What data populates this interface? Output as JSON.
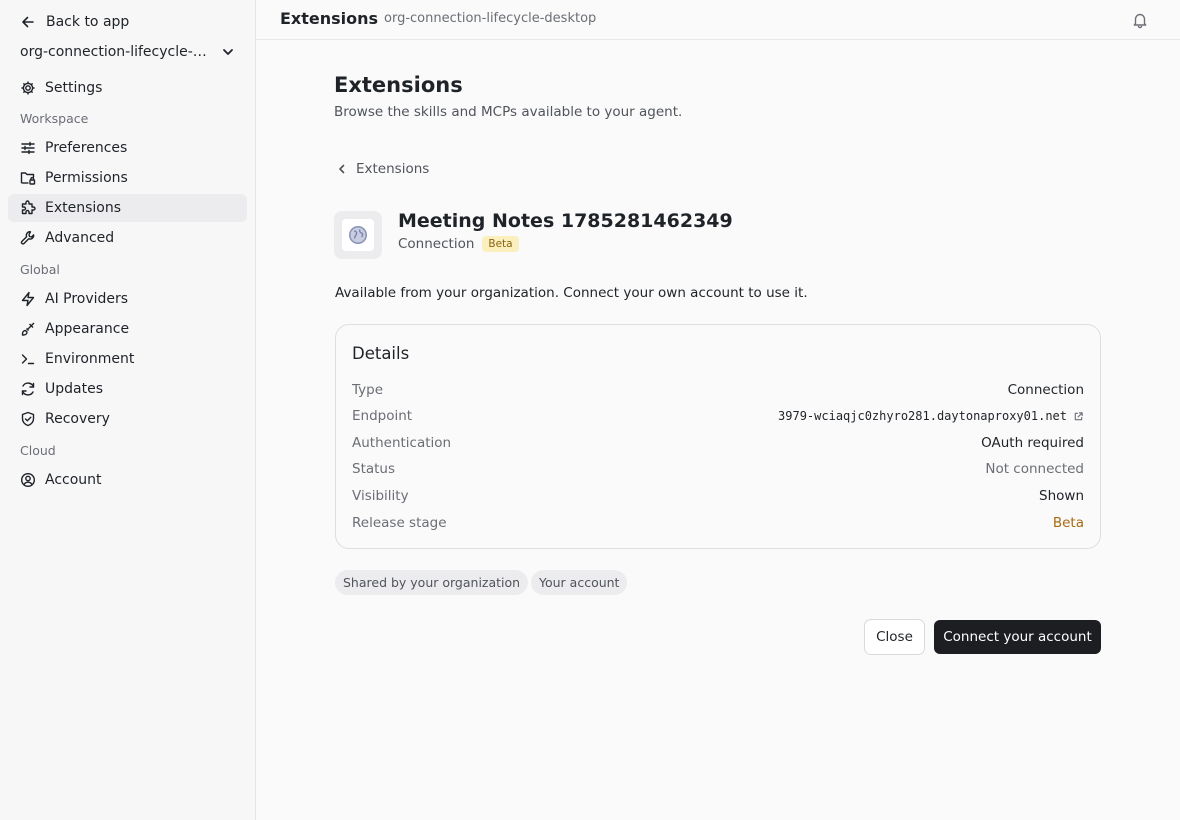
{
  "sidebar": {
    "back_label": "Back to app",
    "org_name": "org-connection-lifecycle-desktop",
    "settings_label": "Settings",
    "sections": {
      "workspace": "Workspace",
      "global": "Global",
      "cloud": "Cloud"
    },
    "items": {
      "preferences": "Preferences",
      "permissions": "Permissions",
      "extensions": "Extensions",
      "advanced": "Advanced",
      "ai_providers": "AI Providers",
      "appearance": "Appearance",
      "environment": "Environment",
      "updates": "Updates",
      "recovery": "Recovery",
      "account": "Account"
    },
    "active_item": "extensions"
  },
  "topbar": {
    "title": "Extensions",
    "subtitle": "org-connection-lifecycle-desktop"
  },
  "main": {
    "heading": "Extensions",
    "description": "Browse the skills and MCPs available to your agent.",
    "breadcrumb": "Extensions",
    "extension": {
      "name": "Meeting Notes 1785281462349",
      "type": "Connection",
      "badge": "Beta",
      "icon": "globe-icon"
    },
    "availability": "Available from your organization. Connect your own account to use it.",
    "details": {
      "title": "Details",
      "type_label": "Type",
      "type_value": "Connection",
      "endpoint_label": "Endpoint",
      "endpoint_value": "3979-wciaqjc0zhyro281.daytonaproxy01.net",
      "auth_label": "Authentication",
      "auth_value": "OAuth required",
      "status_label": "Status",
      "status_value": "Not connected",
      "visibility_label": "Visibility",
      "visibility_value": "Shown",
      "release_label": "Release stage",
      "release_value": "Beta"
    },
    "chips": [
      "Shared by your organization",
      "Your account"
    ],
    "close_label": "Close",
    "connect_label": "Connect your account"
  },
  "colors": {
    "accent_dark": "#1c1e22",
    "beta_text": "#a86a10",
    "beta_badge_bg": "#fbf0bd"
  }
}
